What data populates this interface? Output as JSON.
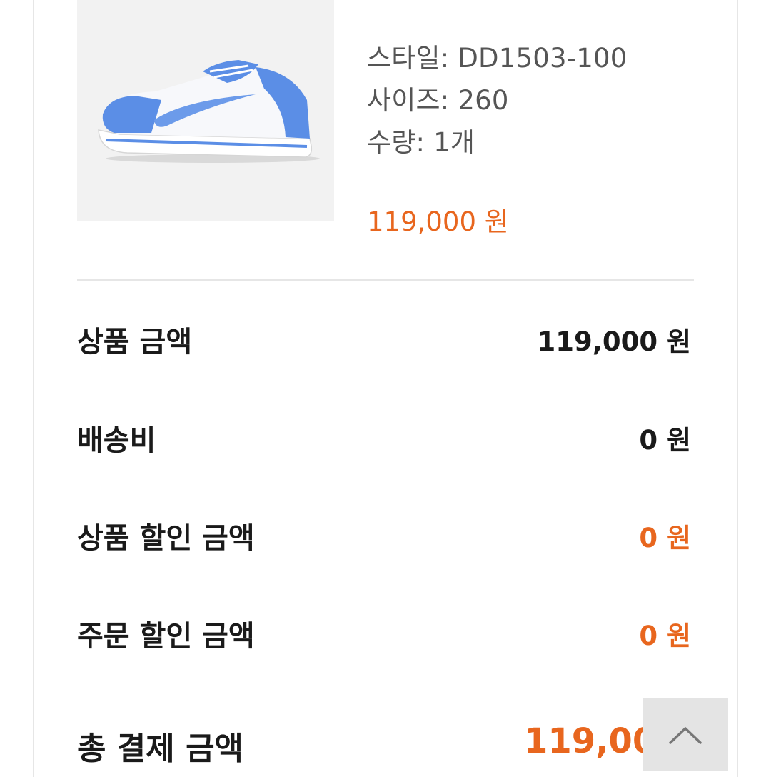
{
  "product": {
    "style": "스타일: DD1503-100",
    "size": "사이즈: 260",
    "quantity": "수량: 1개",
    "price": "119,000 원",
    "image_icon": "blue-white-sneaker"
  },
  "summary": [
    {
      "label": "상품 금액",
      "value": "119,000 원",
      "accent": false
    },
    {
      "label": "배송비",
      "value": "0 원",
      "accent": false
    },
    {
      "label": "상품 할인 금액",
      "value": "0 원",
      "accent": true
    },
    {
      "label": "주문 할인 금액",
      "value": "0 원",
      "accent": true
    }
  ],
  "total": {
    "label": "총 결제 금액",
    "value": "119,000"
  },
  "scroll_top_icon": "chevron-up-icon",
  "colors": {
    "accent": "#e8661e",
    "text": "#1a1a1a",
    "muted": "#555555",
    "divider": "#e6e6e6",
    "scroll_button_bg": "#e4e4e4"
  }
}
